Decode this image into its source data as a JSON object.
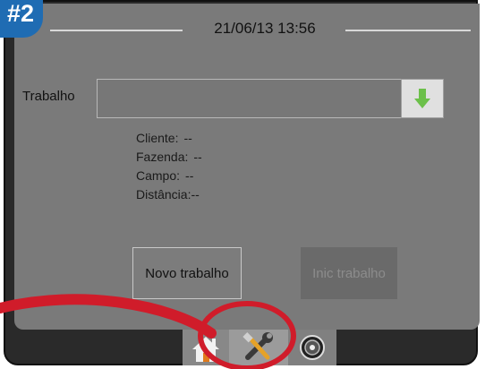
{
  "step_badge": "#2",
  "header": {
    "datetime": "21/06/13 13:56"
  },
  "job": {
    "label": "Trabalho",
    "value": "",
    "dropdown_icon": "arrow-down-icon",
    "dropdown_color": "#6cc04a"
  },
  "details": [
    {
      "label": "Cliente:",
      "value": "--"
    },
    {
      "label": "Fazenda:",
      "value": "--"
    },
    {
      "label": "Campo:",
      "value": "--"
    },
    {
      "label": "Distância:",
      "value": "--"
    }
  ],
  "buttons": {
    "new_job": "Novo trabalho",
    "start_job": "Inic trabalho"
  },
  "tabs": [
    {
      "icon": "home-icon"
    },
    {
      "icon": "tools-icon",
      "highlighted": true
    },
    {
      "icon": "gauge-icon"
    }
  ],
  "colors": {
    "badge": "#1f6cb3",
    "callout": "#d01c2a",
    "panel": "#7a7a7a"
  }
}
